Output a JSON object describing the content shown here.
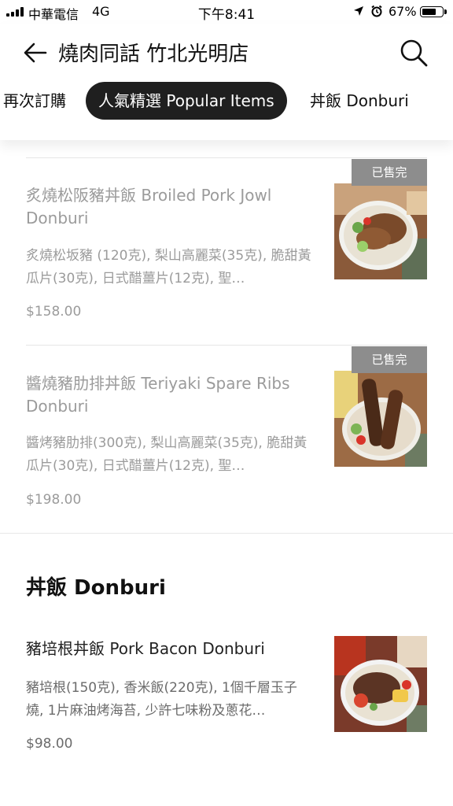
{
  "status_bar": {
    "carrier": "中華電信",
    "network": "4G",
    "time": "下午8:41",
    "battery_percent": "67%",
    "battery_level": 0.67
  },
  "header": {
    "store_title": "燒肉同話 竹北光明店",
    "icons": {
      "back": "arrow-left-icon",
      "search": "search-icon"
    }
  },
  "tabs": [
    {
      "label": "再次訂購",
      "active": false
    },
    {
      "label": "人氣精選 Popular Items",
      "active": true
    },
    {
      "label": "丼飯 Donburi",
      "active": false
    }
  ],
  "popular_items": [
    {
      "name": "炙燒松阪豬丼飯 Broiled Pork Jowl Donburi",
      "description": "炙燒松坂豬 (120克), 梨山高麗菜(35克), 脆甜黃瓜片(30克), 日式醋薑片(12克), 聖…",
      "price": "$158.00",
      "badge": "已售完",
      "sold_out": true
    },
    {
      "name": "醬燒豬肋排丼飯 Teriyaki Spare Ribs Donburi",
      "description": "醬烤豬肋排(300克), 梨山高麗菜(35克), 脆甜黃瓜片(30克), 日式醋薑片(12克), 聖…",
      "price": "$198.00",
      "badge": "已售完",
      "sold_out": true
    }
  ],
  "donburi_section": {
    "heading": "丼飯 Donburi",
    "items": [
      {
        "name": "豬培根丼飯 Pork Bacon Donburi",
        "description": "豬培根(150克), 香米飯(220克), 1個千層玉子燒, 1片麻油烤海苔, 少許七味粉及蔥花…",
        "price": "$98.00",
        "sold_out": false
      }
    ]
  },
  "colors": {
    "active_tab_bg": "#1f1f1f",
    "sold_out_badge_bg": "#8d8d8d",
    "muted_text": "#9b9b9b"
  }
}
